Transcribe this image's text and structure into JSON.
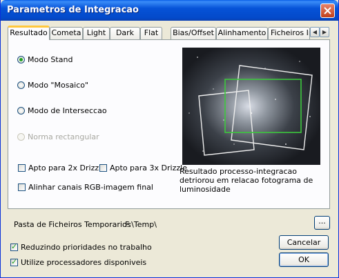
{
  "window": {
    "title": "Parametros de Integracao"
  },
  "tabs": [
    {
      "label": "Resultado",
      "active": true
    },
    {
      "label": "Cometa"
    },
    {
      "label": "Light"
    },
    {
      "label": "Dark"
    },
    {
      "label": "Flat"
    },
    {
      "label": "Bias/Offset"
    },
    {
      "label": "Alinhamento"
    },
    {
      "label": "Ficheiros Inte"
    }
  ],
  "tab_scroll": {
    "left": "◀",
    "right": "▶"
  },
  "modes": [
    {
      "label": "Modo Stand",
      "selected": true,
      "enabled": true
    },
    {
      "label": "Modo \"Mosaico\"",
      "selected": false,
      "enabled": true
    },
    {
      "label": "Modo de Interseccao",
      "selected": false,
      "enabled": true
    },
    {
      "label": "Norma rectangular",
      "selected": false,
      "enabled": false
    }
  ],
  "options": {
    "drizzle2x": {
      "label": "Apto para 2x Drizzle",
      "checked": false
    },
    "drizzle3x": {
      "label": "Apto para 3x Drizzle",
      "checked": false
    },
    "align_rgb": {
      "label": "Alinhar canais RGB-imagem final",
      "checked": false
    }
  },
  "preview": {
    "caption": "Resultado processo-integracao detriorou em relacao fotograma de luminosidade"
  },
  "temp_folder": {
    "label": "Pasta de Ficheiros Temporarios",
    "path": "F:\\Temp\\",
    "browse_label": "..."
  },
  "bottom_checks": {
    "reduce_priority": {
      "label": "Reduzindo prioridades no trabalho",
      "checked": true
    },
    "use_processors": {
      "label": "Utilize processadores disponiveis",
      "checked": true
    }
  },
  "buttons": {
    "cancel": "Cancelar",
    "ok": "OK"
  },
  "colors": {
    "titlebar": "#0653d8",
    "active_tab_accent": "#ffc83c",
    "radio_dot": "#21a121",
    "overlap_frame": "#3cc83c"
  }
}
